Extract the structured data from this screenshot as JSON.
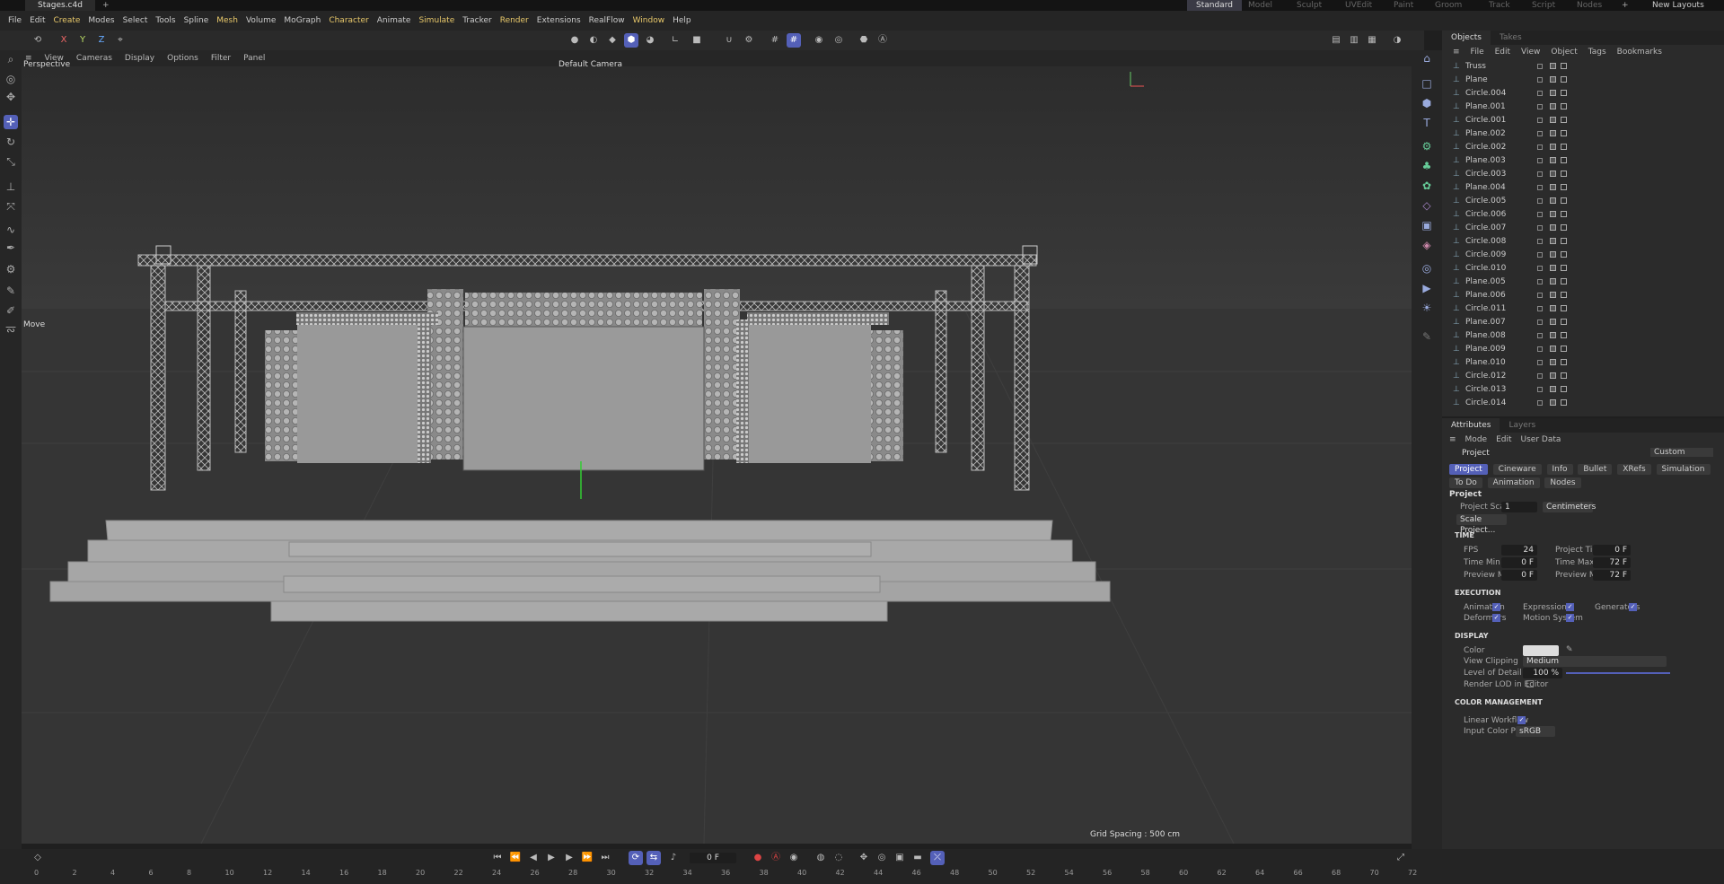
{
  "titlebar": {
    "tab": "Stages.c4d",
    "layouts": [
      "Standard",
      "Model",
      "Sculpt",
      "UVEdit",
      "Paint",
      "Groom",
      "Track",
      "Script",
      "Nodes"
    ],
    "new_layouts": "New Layouts"
  },
  "menu": [
    "File",
    "Edit",
    "Create",
    "Modes",
    "Select",
    "Tools",
    "Spline",
    "Mesh",
    "Volume",
    "MoGraph",
    "Character",
    "Animate",
    "Simulate",
    "Tracker",
    "Render",
    "Extensions",
    "RealFlow",
    "Window",
    "Help"
  ],
  "viewport": {
    "menu": [
      "View",
      "Cameras",
      "Display",
      "Options",
      "Filter",
      "Panel"
    ],
    "view_name": "Perspective",
    "camera": "Default Camera",
    "tool_label": "Move",
    "grid_spacing": "Grid Spacing : 500 cm"
  },
  "objects": {
    "tabs": [
      "Objects",
      "Takes"
    ],
    "menu": [
      "File",
      "Edit",
      "View",
      "Object",
      "Tags",
      "Bookmarks"
    ],
    "items": [
      "Truss",
      "Plane",
      "Circle.004",
      "Plane.001",
      "Circle.001",
      "Plane.002",
      "Circle.002",
      "Plane.003",
      "Circle.003",
      "Plane.004",
      "Circle.005",
      "Circle.006",
      "Circle.007",
      "Circle.008",
      "Circle.009",
      "Circle.010",
      "Plane.005",
      "Plane.006",
      "Circle.011",
      "Plane.007",
      "Plane.008",
      "Plane.009",
      "Plane.010",
      "Circle.012",
      "Circle.013",
      "Circle.014"
    ]
  },
  "attributes": {
    "tabs": [
      "Attributes",
      "Layers"
    ],
    "menu": [
      "Mode",
      "Edit",
      "User Data"
    ],
    "object": "Project",
    "preset": "Custom",
    "buttons": [
      "Project",
      "Cineware",
      "Info",
      "Bullet",
      "XRefs",
      "Simulation",
      "To Do",
      "Animation",
      "Nodes"
    ],
    "heading": "Project",
    "project_scale_label": "Project Scale",
    "project_scale": "1",
    "scale_unit": "Centimeters",
    "scale_btn": "Scale Project...",
    "time": {
      "title": "TIME",
      "fps_l": "FPS",
      "fps": "24",
      "ptime_l": "Project Time",
      "ptime": "0 F",
      "tmin_l": "Time Min",
      "tmin": "0 F",
      "tmax_l": "Time Max",
      "tmax": "72 F",
      "pmin_l": "Preview Min",
      "pmin": "0 F",
      "pmax_l": "Preview Max",
      "pmax": "72 F"
    },
    "exec": {
      "title": "EXECUTION",
      "animation": "Animation",
      "expression": "Expression",
      "generators": "Generators",
      "deformers": "Deformers",
      "motion": "Motion System"
    },
    "display": {
      "title": "DISPLAY",
      "color": "Color",
      "clipping_l": "View Clipping",
      "clipping": "Medium",
      "lod_l": "Level of Detail",
      "lod": "100 %",
      "render_lod": "Render LOD in Editor"
    },
    "color_mgmt": {
      "title": "COLOR MANAGEMENT",
      "linear": "Linear Workflow",
      "profile_l": "Input Color Profile",
      "profile": "sRGB"
    }
  },
  "timeline": {
    "frame": "0 F",
    "ticks": [
      "0",
      "2",
      "4",
      "6",
      "8",
      "10",
      "12",
      "14",
      "16",
      "18",
      "20",
      "22",
      "24",
      "26",
      "28",
      "30",
      "32",
      "34",
      "36",
      "38",
      "40",
      "42",
      "44",
      "46",
      "48",
      "50",
      "52",
      "54",
      "56",
      "58",
      "60",
      "62",
      "64",
      "66",
      "68",
      "70",
      "72"
    ]
  }
}
